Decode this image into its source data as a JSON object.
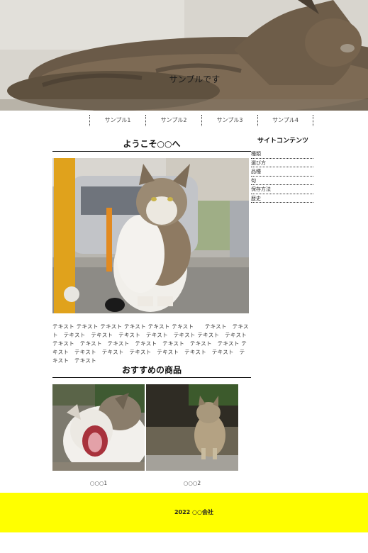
{
  "header": {
    "title": "サンプルです"
  },
  "nav": {
    "items": [
      "サンプル1",
      "サンプル2",
      "サンプル3",
      "サンプル4"
    ]
  },
  "main": {
    "heading": "ようこそ○○へ",
    "body_text": "テキスト テキスト テキスト テキスト テキスト テキスト　　テキスト　テキスト　テキスト　テキスト　テキスト　テキスト　テキスト テキスト　テキスト　テキスト　テキスト　テキスト　テキスト　テキスト　テキスト　テキスト テキスト　テキスト　テキスト　テキスト　テキスト　テキスト　テキスト　テキスト　テキスト",
    "products_heading": "おすすめの商品",
    "products": [
      {
        "caption": "○○○1"
      },
      {
        "caption": "○○○2"
      }
    ]
  },
  "sidebar": {
    "heading": "サイトコンテンツ",
    "items": [
      "種類",
      "選び方",
      "品種",
      "旬",
      "保存方法",
      "歴史"
    ]
  },
  "footer": {
    "text": "2022 ○○会社"
  },
  "colors": {
    "footer_bg": "#ffff00"
  }
}
